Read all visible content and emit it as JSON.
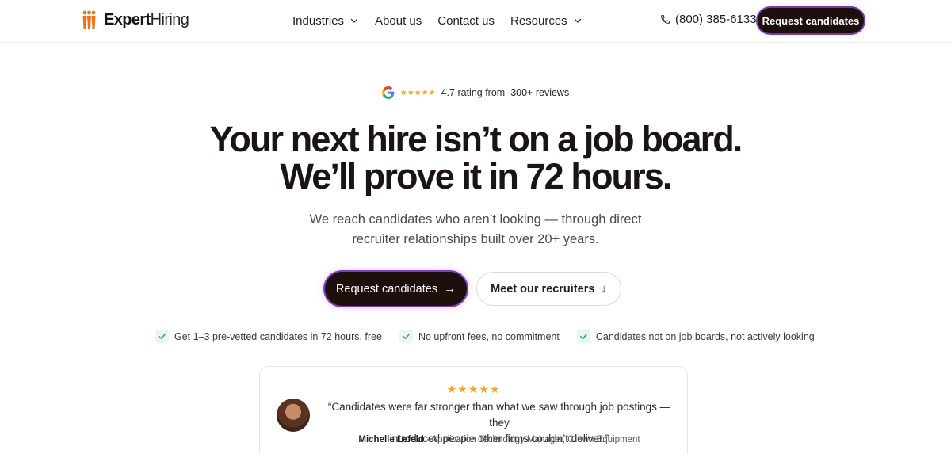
{
  "brand": {
    "name_bold": "Expert",
    "name_light": "Hiring",
    "accent": "#e8761e",
    "dark": "#1c0f0c"
  },
  "nav": {
    "items": [
      {
        "label": "Industries",
        "has_dropdown": true
      },
      {
        "label": "About us",
        "has_dropdown": false
      },
      {
        "label": "Contact us",
        "has_dropdown": false
      },
      {
        "label": "Resources",
        "has_dropdown": true
      }
    ],
    "phone": "(800) 385-6133",
    "cta_label": "Request candidates"
  },
  "rating": {
    "score_text": "4.7 rating from",
    "link_text": "300+ reviews",
    "stars": "★★★★★",
    "icon": "google-icon"
  },
  "hero": {
    "headline_line1": "Your next hire isn’t on a job board.",
    "headline_line2": "We’ll prove it in 72 hours.",
    "sub_line1": "We reach candidates who aren’t looking — through direct",
    "sub_line2": "recruiter relationships built over 20+ years.",
    "primary_cta": "Request candidates",
    "primary_arrow": "→",
    "secondary_cta": "Meet our recruiters",
    "secondary_arrow": "↓"
  },
  "checks": [
    "Get 1–3 pre-vetted candidates in 72 hours, free",
    "No upfront fees, no commitment",
    "Candidates not on job boards, not actively looking"
  ],
  "testimonial": {
    "stars": "★★★★★",
    "quote_line1": "“Candidates were far stronger than what we saw through job postings — they",
    "quote_line2": "introduced people other firms couldn’t deliver.”",
    "author_name": "Michelle Lefeld",
    "author_role": " · Application Technology Manager, Crown Equipment"
  }
}
